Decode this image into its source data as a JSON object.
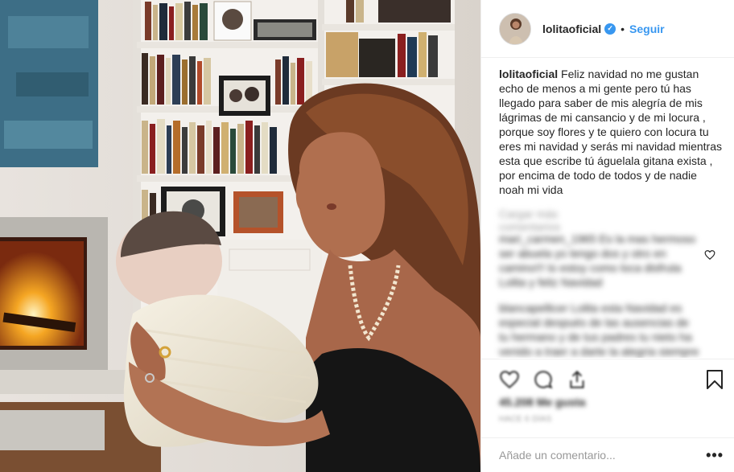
{
  "post": {
    "username": "lolitaoficial",
    "verified_icon": "verified-badge-icon",
    "separator": "•",
    "follow_label": "Seguir",
    "caption_user": "lolitaoficial",
    "caption_text": "Feliz navidad no me gustan echo de menos a mi gente pero tú has llegado para saber de mis alegría de mis lágrimas de mi cansancio y de mi locura , porque soy flores y te quiero con locura tu eres mi navidad y serás mi navidad mientras esta que escribe tú águelala gitana exista , por encima de todo de todos y de nadie noah mi vida"
  },
  "comments": {
    "load_more": "Cargar más comentarios",
    "items": [
      {
        "text": "mari_carmen_1965 Es la mas hermoso ser abuela yo tengo dos y otro en camino!!! lo estoy como loca disfruta Lolita y feliz Navidad"
      },
      {
        "text": "blancapellicer Lolita esta Navidad es especial después de las ausencias de tu hermano y de tus padres tu nieto ha venido a traer a darte la alegría siempre que vayan todos"
      }
    ]
  },
  "actions": {
    "like_icon": "heart-icon",
    "comment_icon": "comment-icon",
    "share_icon": "share-icon",
    "save_icon": "bookmark-icon"
  },
  "stats": {
    "likes": "45.208 Me gusta",
    "date": "HACE 6 DÍAS"
  },
  "add_comment": {
    "placeholder": "Añade un comentario...",
    "more_label": "•••"
  },
  "colors": {
    "accent": "#3897f0",
    "text": "#262626",
    "muted": "#999999",
    "border": "#efefef"
  }
}
